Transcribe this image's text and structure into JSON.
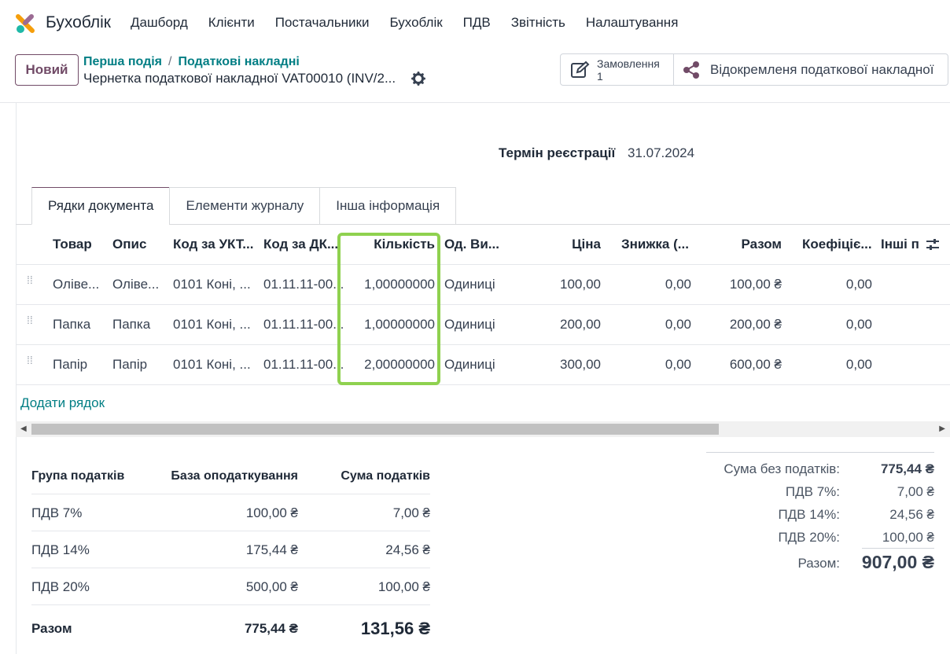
{
  "app": {
    "name": "Бухоблік"
  },
  "menu": [
    "Дашборд",
    "Клієнти",
    "Постачальники",
    "Бухоблік",
    "ПДВ",
    "Звітність",
    "Налаштування"
  ],
  "control": {
    "new_label": "Новий",
    "breadcrumb": [
      "Перша подія",
      "Податкові накладні"
    ],
    "record_title": "Чернетка податкової накладної VAT00010 (INV/2...",
    "smart_orders_label": "Замовлення",
    "smart_orders_count": "1",
    "smart_split_label": "Відокремленя податкової накладної"
  },
  "header_fields": {
    "reg_label": "Термін реєстрації",
    "reg_value": "31.07.2024"
  },
  "tabs": [
    "Рядки документа",
    "Елементи журналу",
    "Інша інформація"
  ],
  "lines": {
    "columns": [
      "Товар",
      "Опис",
      "Код за УКТ...",
      "Код за ДК...",
      "Кількість",
      "Од. Ви...",
      "Ціна",
      "Знижка (...",
      "Разом",
      "Коефіціє...",
      "Інші п"
    ],
    "rows": [
      [
        "Оліве...",
        "Оліве...",
        "0101 Коні, ...",
        "01.11.11-00...",
        "1,00000000",
        "Одиниці",
        "100,00",
        "0,00",
        "100,00 ₴",
        "0,00"
      ],
      [
        "Папка",
        "Папка",
        "0101 Коні, ...",
        "01.11.11-00...",
        "1,00000000",
        "Одиниці",
        "200,00",
        "0,00",
        "200,00 ₴",
        "0,00"
      ],
      [
        "Папір",
        "Папір",
        "0101 Коні, ...",
        "01.11.11-00...",
        "2,00000000",
        "Одиниці",
        "300,00",
        "0,00",
        "600,00 ₴",
        "0,00"
      ]
    ],
    "add_line": "Додати рядок"
  },
  "tax_groups": {
    "headers": [
      "Група податків",
      "База оподаткування",
      "Сума податків"
    ],
    "rows": [
      [
        "ПДВ 7%",
        "100,00 ₴",
        "7,00 ₴"
      ],
      [
        "ПДВ 14%",
        "175,44 ₴",
        "24,56 ₴"
      ],
      [
        "ПДВ 20%",
        "500,00 ₴",
        "100,00 ₴"
      ]
    ],
    "total": [
      "Разом",
      "775,44 ₴",
      "131,56 ₴"
    ]
  },
  "totals": {
    "rows": [
      [
        "Сума без податків:",
        "775,44 ₴"
      ],
      [
        "ПДВ 7%:",
        "7,00 ₴"
      ],
      [
        "ПДВ 14%:",
        "24,56 ₴"
      ],
      [
        "ПДВ 20%:",
        "100,00 ₴"
      ]
    ],
    "grand_label": "Разом:",
    "grand_value": "907,00 ₴"
  },
  "colors": {
    "primary": "#714b67",
    "link": "#017e84",
    "highlight": "#8fd14f"
  }
}
